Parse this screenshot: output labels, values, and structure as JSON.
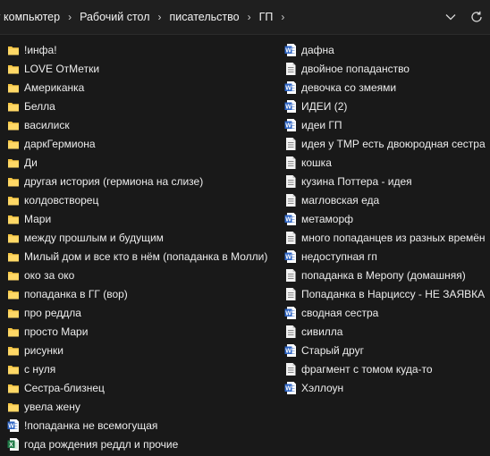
{
  "breadcrumb": {
    "items": [
      "г компьютер",
      "Рабочий стол",
      "писательство",
      "ГП"
    ],
    "separator": "›"
  },
  "colors": {
    "background": "#191919",
    "folder": "#f5c542",
    "word": "#2b63c4",
    "text_doc": "#f2f2f2",
    "excel": "#1d7a45"
  },
  "files": {
    "column1": [
      {
        "name": "!инфа!",
        "type": "folder"
      },
      {
        "name": "LOVE ОтМетки",
        "type": "folder"
      },
      {
        "name": "Американка",
        "type": "folder"
      },
      {
        "name": "Белла",
        "type": "folder"
      },
      {
        "name": "василиск",
        "type": "folder"
      },
      {
        "name": "даркГермиона",
        "type": "folder"
      },
      {
        "name": "Ди",
        "type": "folder"
      },
      {
        "name": "другая история (гермиона на слизе)",
        "type": "folder"
      },
      {
        "name": "колдовстворец",
        "type": "folder"
      },
      {
        "name": "Мари",
        "type": "folder"
      },
      {
        "name": "между прошлым и будущим",
        "type": "folder"
      },
      {
        "name": "Милый дом и все кто в нём (попаданка в Молли)",
        "type": "folder"
      },
      {
        "name": "око за око",
        "type": "folder"
      },
      {
        "name": "попаданка в ГГ (вор)",
        "type": "folder"
      },
      {
        "name": "про реддла",
        "type": "folder"
      },
      {
        "name": "просто Мари",
        "type": "folder"
      },
      {
        "name": "рисунки",
        "type": "folder"
      },
      {
        "name": "с нуля",
        "type": "folder"
      },
      {
        "name": "Сестра-близнец",
        "type": "folder"
      },
      {
        "name": "увела жену",
        "type": "folder"
      },
      {
        "name": "!попаданка не всемогущая",
        "type": "word"
      },
      {
        "name": "года рождения реддл и прочие",
        "type": "excel"
      }
    ],
    "column2": [
      {
        "name": "дафна",
        "type": "word"
      },
      {
        "name": "двойное попаданство",
        "type": "text"
      },
      {
        "name": "девочка со змеями",
        "type": "word"
      },
      {
        "name": "ИДЕИ (2)",
        "type": "word"
      },
      {
        "name": "идеи ГП",
        "type": "word"
      },
      {
        "name": "идея у ТМР есть двоюродная сестра",
        "type": "text"
      },
      {
        "name": "кошка",
        "type": "text"
      },
      {
        "name": "кузина Поттера - идея",
        "type": "text"
      },
      {
        "name": "магловская еда",
        "type": "text"
      },
      {
        "name": "метаморф",
        "type": "word"
      },
      {
        "name": "много попаданцев из разных времён",
        "type": "text"
      },
      {
        "name": "недоступная гп",
        "type": "word"
      },
      {
        "name": "попаданка в Меропу (домашняя)",
        "type": "text"
      },
      {
        "name": "Попаданка в Нарциссу - НЕ ЗАЯВКА",
        "type": "text"
      },
      {
        "name": "сводная сестра",
        "type": "word"
      },
      {
        "name": "сивилла",
        "type": "text"
      },
      {
        "name": "Старый друг",
        "type": "word"
      },
      {
        "name": "фрагмент с томом куда-то",
        "type": "text"
      },
      {
        "name": "Хэллоун",
        "type": "word"
      }
    ]
  }
}
